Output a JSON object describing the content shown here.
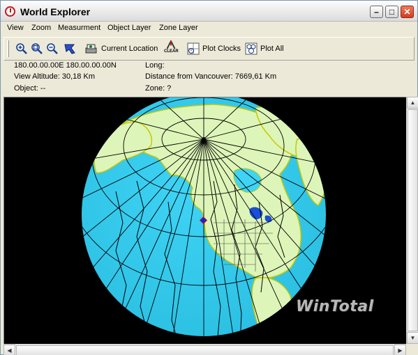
{
  "window": {
    "title": "World Explorer"
  },
  "menu": [
    "View",
    "Zoom",
    "Measurment",
    "Object Layer",
    "Zone Layer"
  ],
  "toolbar": {
    "current_location_label": "Current Location",
    "clear_label": "CLEAR",
    "plot_clocks_label": "Plot Clocks",
    "plot_all_label": "Plot All"
  },
  "info": {
    "coords": "180.00.00.00E 180.00.00.00N",
    "view_altitude": "View Altitude: 30,18 Km",
    "object": "Object: --",
    "long": "Long:",
    "distance": "Distance from Vancouver: 7669,61 Km",
    "zone": "Zone: ?"
  },
  "globe": {
    "watermark": "WinTotal"
  },
  "colors": {
    "ocean": "#33ccee",
    "land": "#ddf5b8",
    "coast": "#c8c800",
    "lakes": "#1a4fd6",
    "background": "#000000"
  },
  "icons": [
    "zoom-in-icon",
    "zoom-fit-icon",
    "zoom-out-icon",
    "pointer-icon",
    "current-location-icon",
    "clear-icon",
    "plot-clocks-icon",
    "plot-all-icon"
  ]
}
